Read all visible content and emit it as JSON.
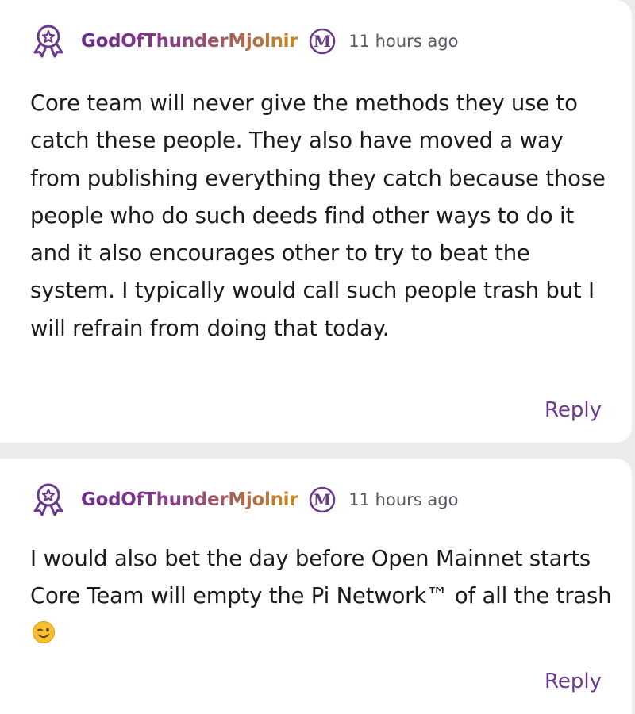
{
  "comments": [
    {
      "username": "GodOfThunderMjolnir",
      "mod_badge_letter": "M",
      "timestamp": "11 hours ago",
      "text": "Core team will never give the methods they use to catch these people. They also have moved a way from publishing everything they catch because those people who do such deeds find other ways to do it and it also encourages other to try to beat the system. I typically would call such people trash but I will refrain from doing that today.",
      "reply_label": "Reply"
    },
    {
      "username": "GodOfThunderMjolnir",
      "mod_badge_letter": "M",
      "timestamp": "11 hours ago",
      "text": "I would also bet the day before Open Mainnet starts Core Team will empty the Pi Network™ of all the trash",
      "emoji": "winking-face-emoji",
      "reply_label": "Reply"
    }
  ],
  "colors": {
    "accent_purple": "#6b3a8d",
    "username_gradient_start": "#6a2c8e",
    "username_gradient_end": "#c98a1c",
    "text": "#1b1b1b",
    "timestamp": "#555a60"
  }
}
